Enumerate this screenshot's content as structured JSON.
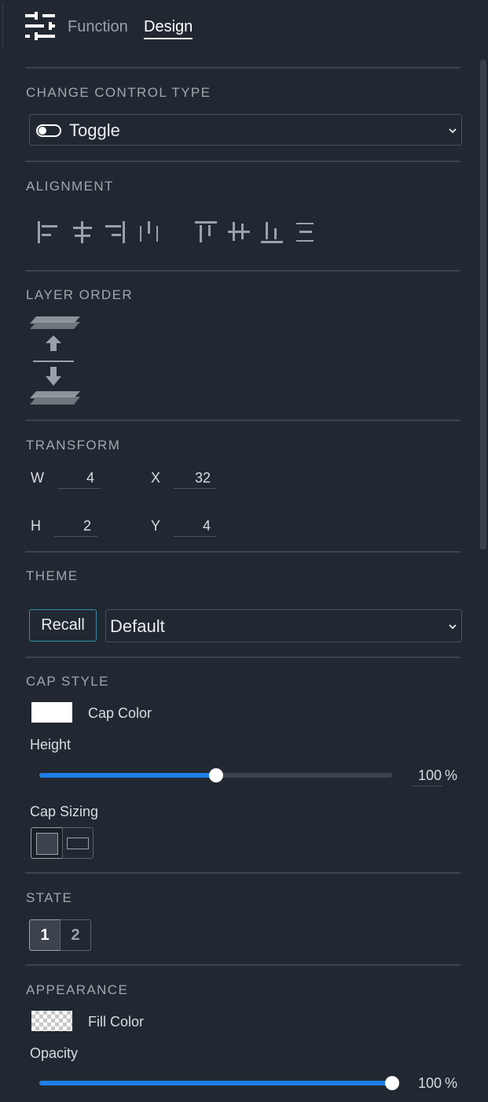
{
  "tabs": {
    "function": "Function",
    "design": "Design"
  },
  "sections": {
    "change_control_type": "CHANGE CONTROL TYPE",
    "alignment": "ALIGNMENT",
    "layer_order": "LAYER ORDER",
    "transform": "TRANSFORM",
    "theme": "THEME",
    "cap_style": "CAP STYLE",
    "state": "STATE",
    "appearance": "APPEARANCE"
  },
  "control_type": {
    "value": "Toggle",
    "icon": "toggle-switch-icon"
  },
  "alignment": {
    "horizontal": [
      "align-left-icon",
      "align-center-horizontal-icon",
      "align-right-icon",
      "distribute-horizontal-icon"
    ],
    "vertical": [
      "align-top-icon",
      "align-center-vertical-icon",
      "align-bottom-icon",
      "distribute-vertical-icon"
    ]
  },
  "layer_order": {
    "up": "bring-forward-icon",
    "down": "send-backward-icon"
  },
  "transform": {
    "w_label": "W",
    "w_value": "4",
    "x_label": "X",
    "x_value": "32",
    "h_label": "H",
    "h_value": "2",
    "y_label": "Y",
    "y_value": "4"
  },
  "theme": {
    "recall_label": "Recall",
    "selected": "Default"
  },
  "cap_style": {
    "cap_color_label": "Cap Color",
    "cap_color": "#ffffff",
    "height_label": "Height",
    "height_value": "100",
    "height_fraction": 0.5,
    "unit": "%",
    "cap_sizing_label": "Cap Sizing",
    "cap_sizing_selected": "square"
  },
  "state": {
    "options": [
      "1",
      "2"
    ],
    "selected": "1"
  },
  "appearance": {
    "fill_color_label": "Fill Color",
    "fill_color": "transparent",
    "opacity_label": "Opacity",
    "opacity_value": "100",
    "opacity_fraction": 1.0,
    "unit": "%"
  },
  "colors": {
    "accent": "#1e7ee8",
    "background": "#222831",
    "recall_border": "#2f8fb0"
  }
}
